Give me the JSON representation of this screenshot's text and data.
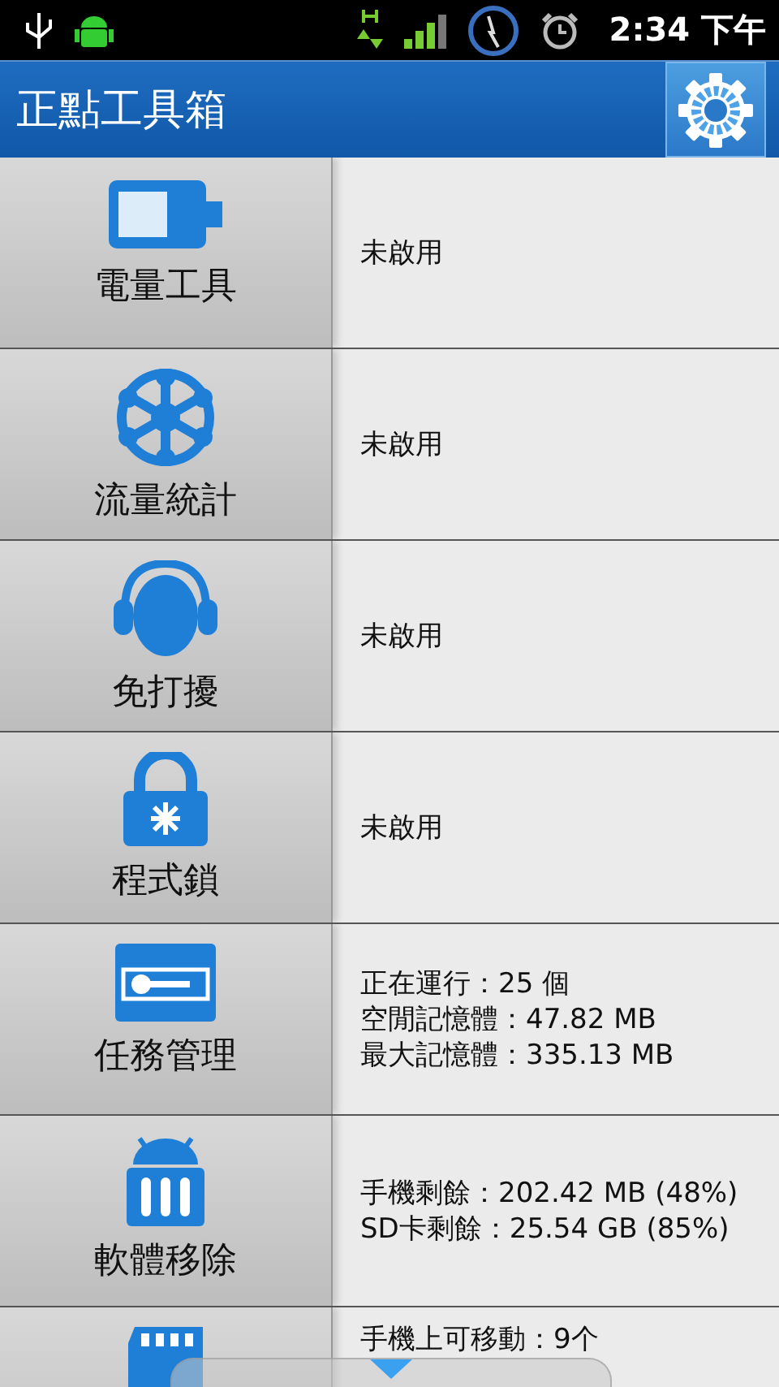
{
  "status_bar": {
    "time": "2:34 下午"
  },
  "title_bar": {
    "title": "正點工具箱"
  },
  "tools": [
    {
      "label": "電量工具",
      "details": [
        "未啟用"
      ]
    },
    {
      "label": "流量統計",
      "details": [
        "未啟用"
      ]
    },
    {
      "label": "免打擾",
      "details": [
        "未啟用"
      ]
    },
    {
      "label": "程式鎖",
      "details": [
        "未啟用"
      ]
    },
    {
      "label": "任務管理",
      "details": [
        "正在運行：25 個",
        "空閒記憶體：47.82 MB",
        "最大記憶體：335.13 MB"
      ]
    },
    {
      "label": "軟體移除",
      "details": [
        "手機剩餘：202.42 MB (48%)",
        "SD卡剩餘：25.54 GB (85%)"
      ]
    },
    {
      "details": [
        "手機上可移動：9个"
      ]
    }
  ]
}
